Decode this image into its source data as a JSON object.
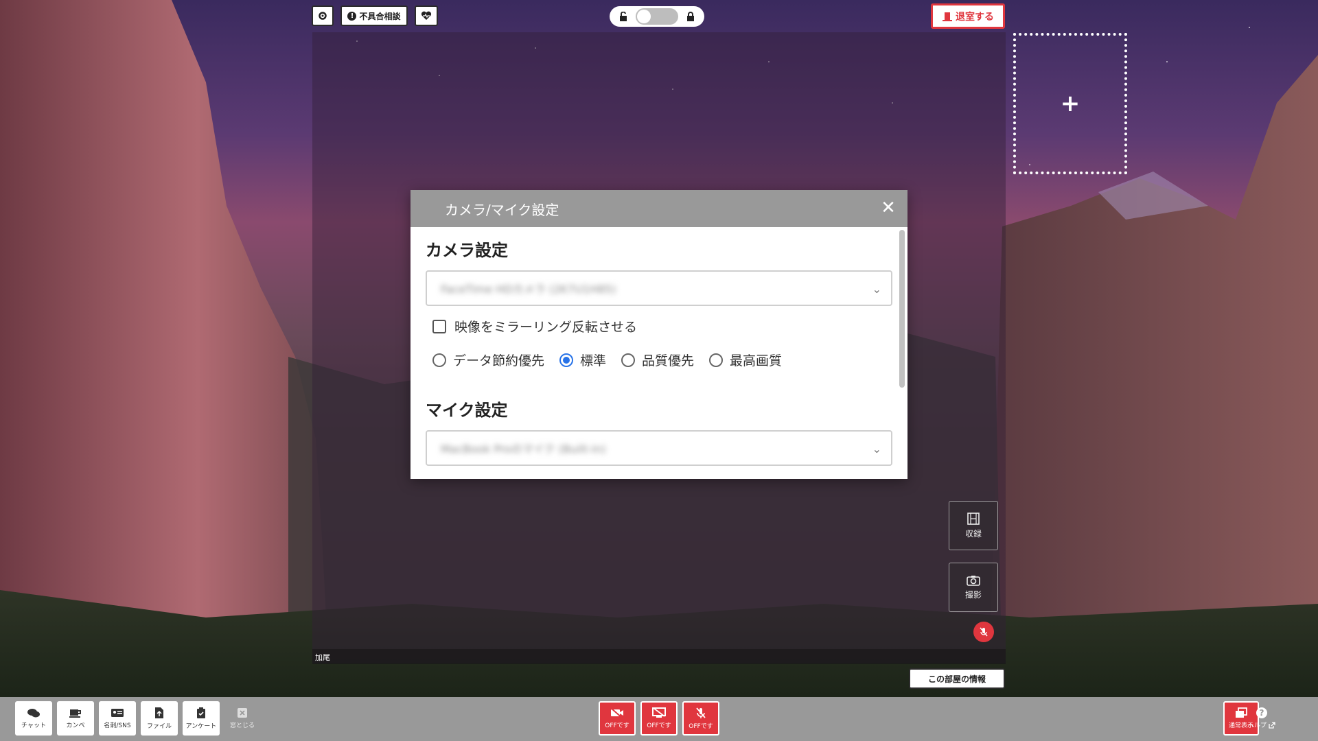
{
  "topbar": {
    "trouble_label": "不具合相談",
    "exit_label": "退室する"
  },
  "video": {
    "participant_name": "加尾",
    "add_slot_symbol": "+"
  },
  "side_tools": {
    "record_label": "収録",
    "photo_label": "撮影"
  },
  "room_info_label": "この部屋の情報",
  "bottom_bar": {
    "chat_label": "チャット",
    "kanpe_label": "カンペ",
    "card_label": "名刺/SNS",
    "file_label": "ファイル",
    "survey_label": "アンケート",
    "close_window_label": "窓とじる",
    "camera_off_label": "OFFです",
    "screen_off_label": "OFFです",
    "mic_off_label": "OFFです",
    "normal_view_label": "通常表示",
    "help_label": "ヘルプ"
  },
  "modal": {
    "title": "カメラ/マイク設定",
    "close_symbol": "✕",
    "camera_section_title": "カメラ設定",
    "camera_select_value": "FaceTime HDカメラ (2K7U1H85)",
    "mirror_label": "映像をミラーリング反転させる",
    "quality_options": [
      "データ節約優先",
      "標準",
      "品質優先",
      "最高画質"
    ],
    "quality_selected_index": 1,
    "mic_section_title": "マイク設定",
    "mic_select_value": "MacBook Proのマイク (Built-in)"
  },
  "colors": {
    "accent_red": "#e0363e",
    "radio_blue": "#2873e8",
    "modal_header_gray": "#999999"
  }
}
